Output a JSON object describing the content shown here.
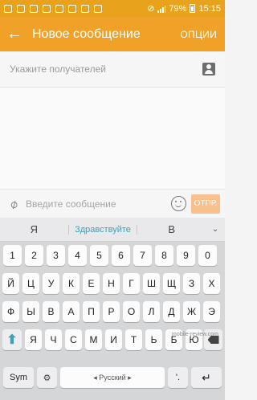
{
  "status_bar": {
    "battery": "79%",
    "time": "15:15"
  },
  "toolbar": {
    "title": "Новое сообщение",
    "options_label": "ОПЦИИ"
  },
  "recipients": {
    "placeholder": "Укажите получателей"
  },
  "compose": {
    "placeholder": "Введите сообщение",
    "send_label": "ОТПР."
  },
  "keyboard": {
    "suggestions": [
      "Я",
      "Здравствуйте",
      "В"
    ],
    "row_numbers": [
      "1",
      "2",
      "3",
      "4",
      "5",
      "6",
      "7",
      "8",
      "9",
      "0"
    ],
    "row1": [
      "Й",
      "Ц",
      "У",
      "К",
      "Е",
      "Н",
      "Г",
      "Ш",
      "Щ",
      "З",
      "Х"
    ],
    "row2": [
      "Ф",
      "Ы",
      "В",
      "А",
      "П",
      "Р",
      "О",
      "Л",
      "Д",
      "Ж",
      "Э"
    ],
    "row3": [
      "Я",
      "Ч",
      "С",
      "М",
      "И",
      "Т",
      "Ь",
      "Б",
      "Ю"
    ],
    "sym_label": "Sym",
    "space_label": "◂ Русский ▸",
    "punct_label": "'.",
    "watermark": "mobile-review.com"
  },
  "colors": {
    "status_bar": "#e8a21c",
    "toolbar": "#f0a228",
    "send_button": "#f9c08e",
    "accent": "#3ea0b4"
  }
}
